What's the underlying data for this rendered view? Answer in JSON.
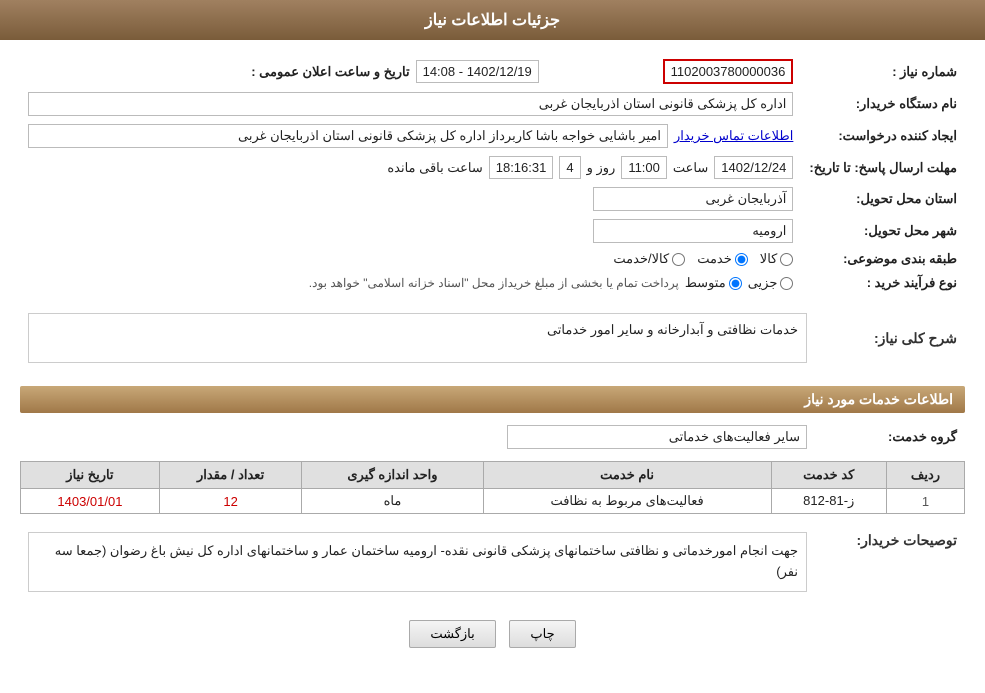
{
  "header": {
    "title": "جزئیات اطلاعات نیاز"
  },
  "fields": {
    "need_number_label": "شماره نیاز :",
    "need_number_value": "1102003780000036",
    "buyer_org_label": "نام دستگاه خریدار:",
    "buyer_org_value": "اداره کل پزشکی قانونی استان اذربایجان غربی",
    "creator_label": "ایجاد کننده درخواست:",
    "creator_value": "امیر باشایی خواجه باشا کاربرداز اداره کل پزشکی قانونی استان اذربایجان غربی",
    "creator_link": "اطلاعات تماس خریدار",
    "announce_time_label": "تاریخ و ساعت اعلان عمومی :",
    "announce_time_value": "1402/12/19 - 14:08",
    "deadline_label": "مهلت ارسال پاسخ: تا تاریخ:",
    "deadline_date": "1402/12/24",
    "deadline_time": "11:00",
    "deadline_days": "4",
    "deadline_time2": "18:16:31",
    "deadline_remaining": "ساعت باقی مانده",
    "province_label": "استان محل تحویل:",
    "province_value": "آذربایجان غربی",
    "city_label": "شهر محل تحویل:",
    "city_value": "ارومیه",
    "category_label": "طبقه بندی موضوعی:",
    "category_options": [
      "کالا",
      "خدمت",
      "کالا/خدمت"
    ],
    "category_selected": "خدمت",
    "purchase_type_label": "نوع فرآیند خرید :",
    "purchase_type_options": [
      "جزیی",
      "متوسط"
    ],
    "purchase_type_note": "پرداخت تمام یا بخشی از مبلغ خریداز محل \"اسناد خزانه اسلامی\" خواهد بود.",
    "need_desc_label": "شرح کلی نیاز:",
    "need_desc_value": "خدمات نظافتی و آبدارخانه و سایر امور خدماتی",
    "services_section_title": "اطلاعات خدمات مورد نیاز",
    "service_group_label": "گروه خدمت:",
    "service_group_value": "سایر فعالیت‌های خدماتی",
    "table": {
      "headers": [
        "ردیف",
        "کد خدمت",
        "نام خدمت",
        "واحد اندازه گیری",
        "تعداد / مقدار",
        "تاریخ نیاز"
      ],
      "rows": [
        {
          "row": "1",
          "code": "ز-81-812",
          "name": "فعالیت‌های مربوط به نظافت",
          "unit": "ماه",
          "qty": "12",
          "date": "1403/01/01"
        }
      ]
    },
    "buyer_desc_label": "توصیحات خریدار:",
    "buyer_desc_value": "جهت انجام امورخدماتی و نظافتی ساختمانهای پزشکی قانونی نقده- ارومیه ساختمان عمار و ساختمانهای اداره کل نیش باغ رضوان (جمعا سه نفر)"
  },
  "buttons": {
    "back": "بازگشت",
    "print": "چاپ"
  }
}
